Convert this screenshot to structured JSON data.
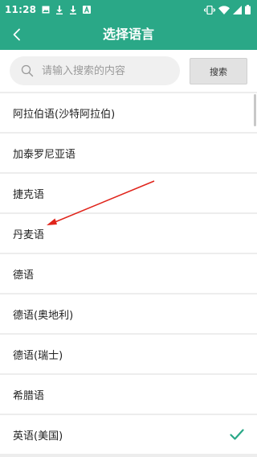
{
  "status_bar": {
    "time": "11:28",
    "icons": [
      "image-icon",
      "download-icon",
      "download-icon",
      "a-app-icon",
      "vibrate-icon",
      "wifi-icon",
      "signal-icon",
      "battery-icon"
    ]
  },
  "header": {
    "title": "选择语言",
    "back_icon": "chevron-left-icon"
  },
  "search": {
    "placeholder": "请输入搜索的内容",
    "button_label": "搜索",
    "icon": "search-icon"
  },
  "languages": [
    {
      "label": "阿拉伯语(沙特阿拉伯)",
      "selected": false
    },
    {
      "label": "加泰罗尼亚语",
      "selected": false
    },
    {
      "label": "捷克语",
      "selected": false
    },
    {
      "label": "丹麦语",
      "selected": false
    },
    {
      "label": "德语",
      "selected": false
    },
    {
      "label": "德语(奥地利)",
      "selected": false
    },
    {
      "label": "德语(瑞士)",
      "selected": false
    },
    {
      "label": "希腊语",
      "selected": false
    },
    {
      "label": "英语(美国)",
      "selected": true
    }
  ],
  "colors": {
    "accent": "#2aa887",
    "annotation_arrow": "#e0241b",
    "check": "#2aa887"
  }
}
